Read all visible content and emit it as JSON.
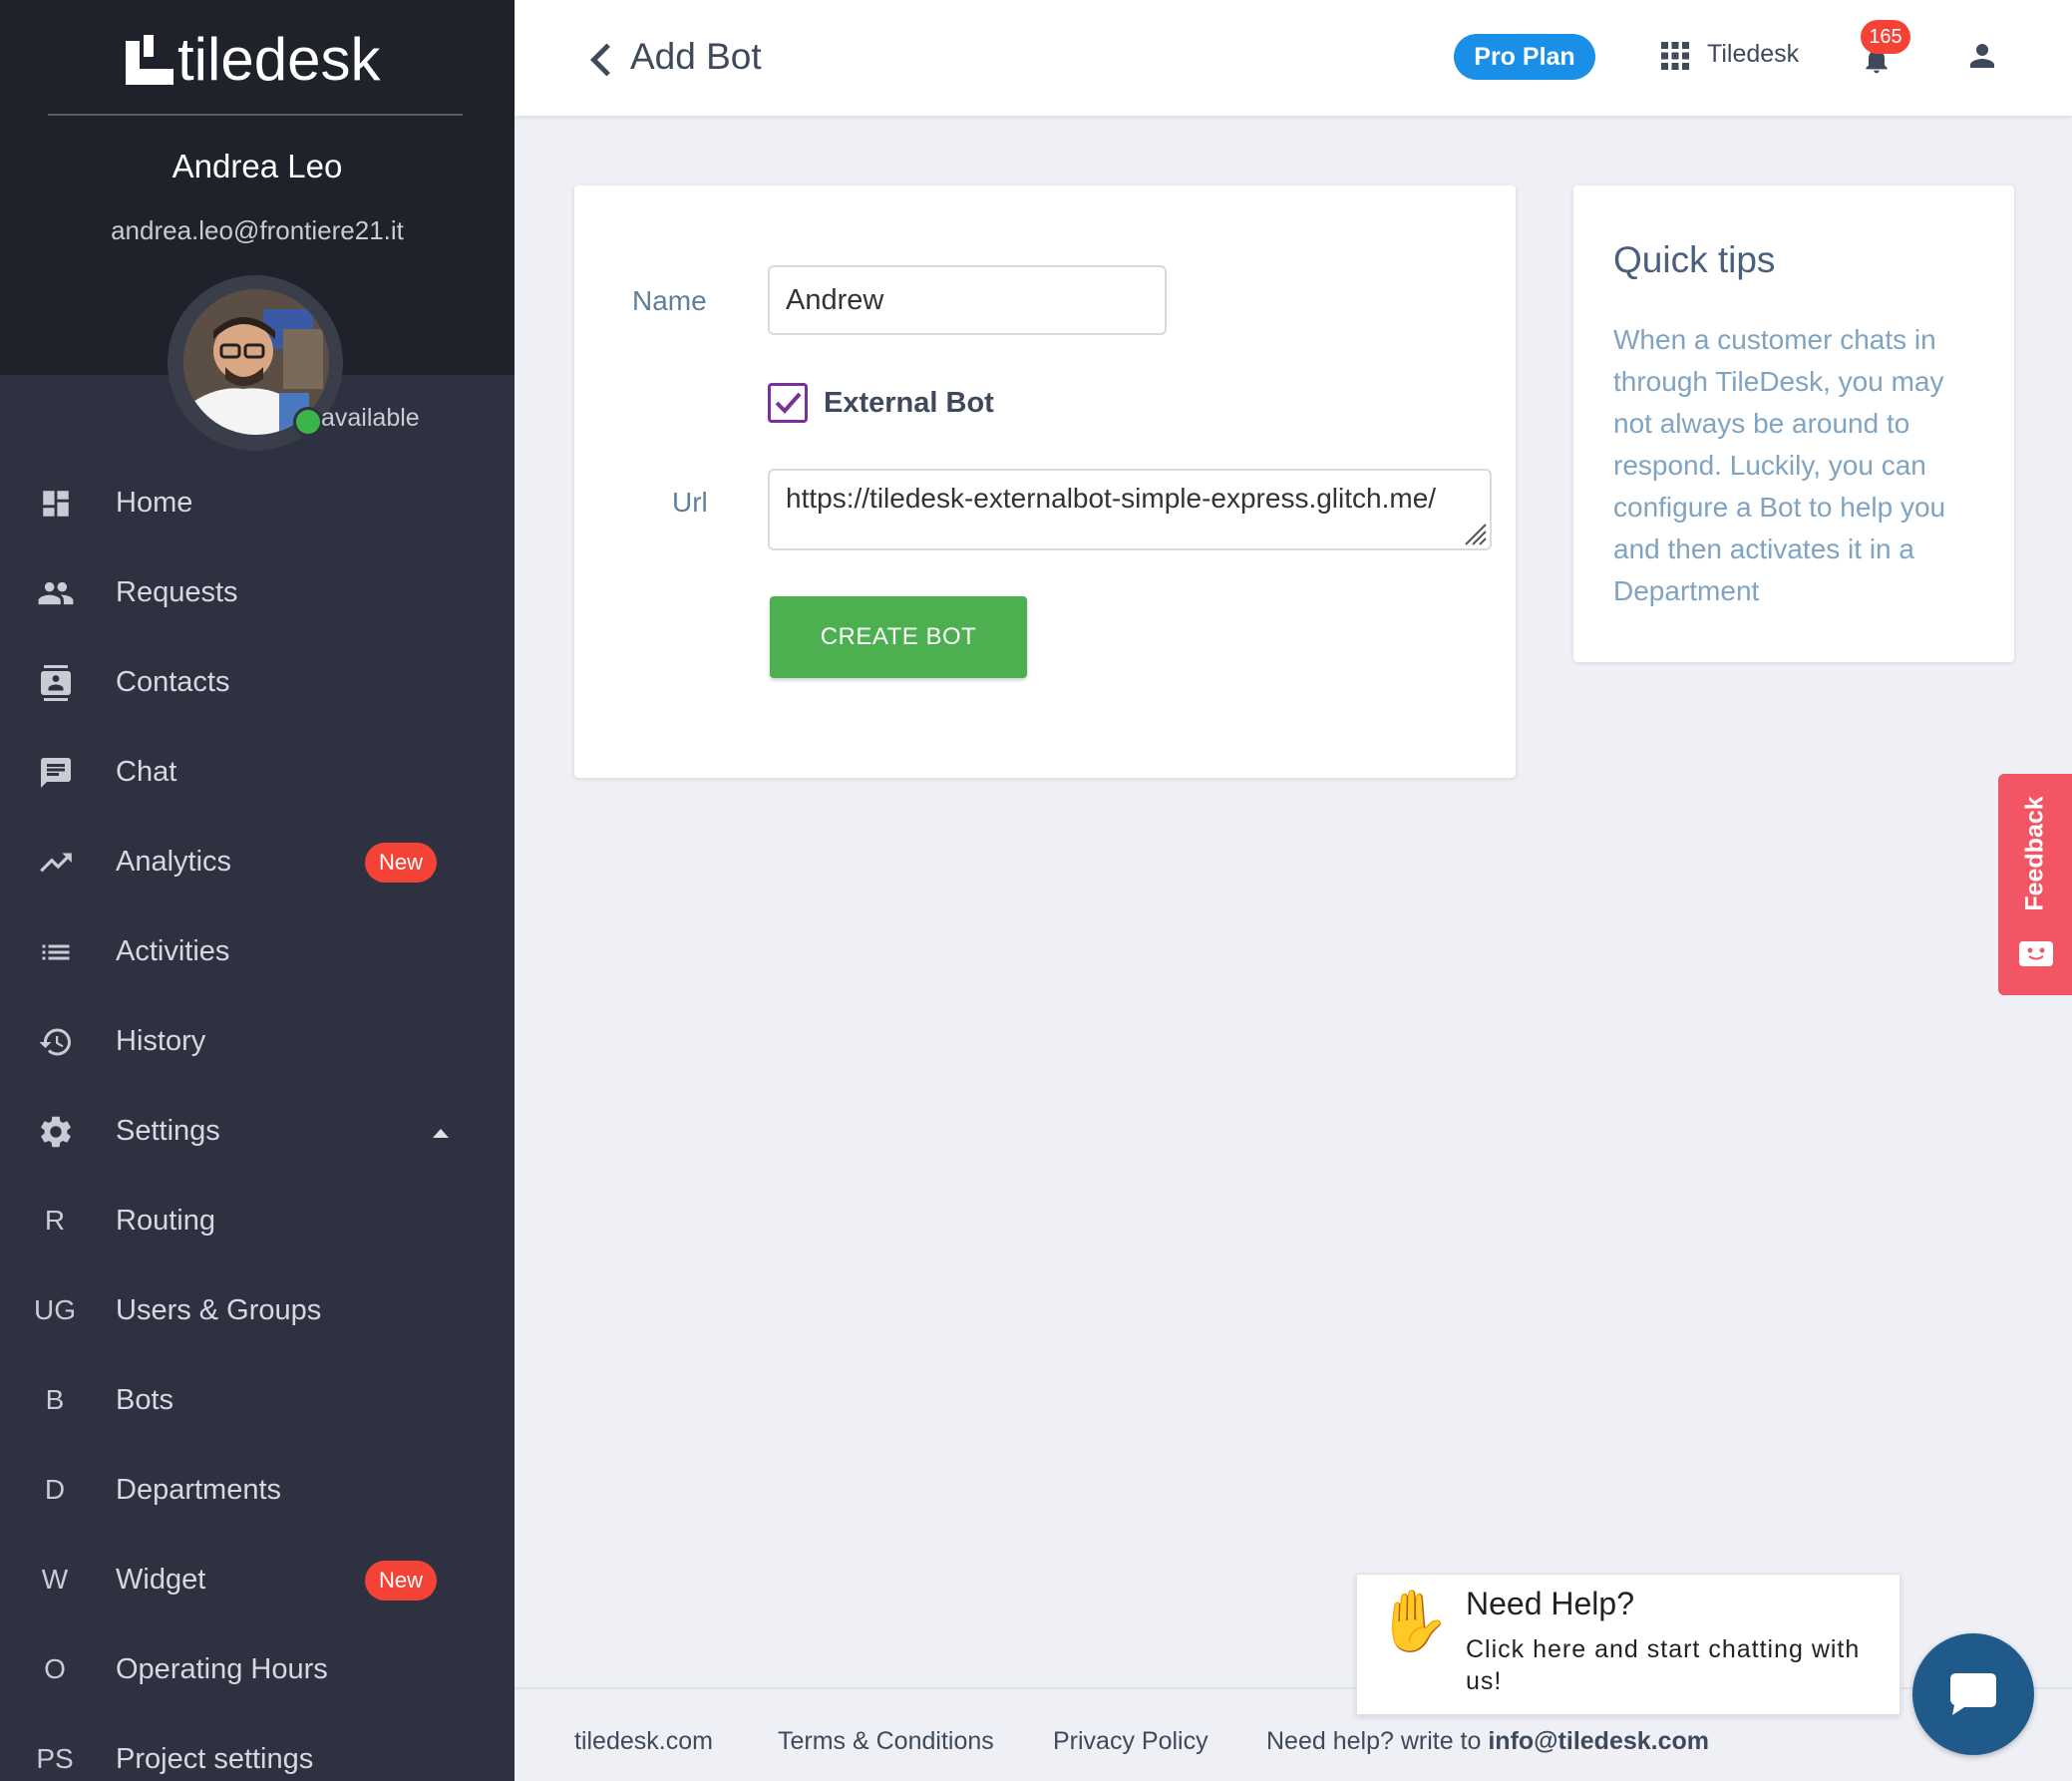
{
  "app": {
    "logo_text": "tiledesk"
  },
  "sidebar": {
    "user_name": "Andrea Leo",
    "user_email": "andrea.leo@frontiere21.it",
    "status": "available",
    "items": [
      {
        "label": "Home",
        "icon": "dashboard-icon"
      },
      {
        "label": "Requests",
        "icon": "people-icon"
      },
      {
        "label": "Contacts",
        "icon": "contacts-icon"
      },
      {
        "label": "Chat",
        "icon": "chat-icon"
      },
      {
        "label": "Analytics",
        "icon": "trending-up-icon",
        "badge": "New"
      },
      {
        "label": "Activities",
        "icon": "list-icon"
      },
      {
        "label": "History",
        "icon": "history-icon"
      },
      {
        "label": "Settings",
        "icon": "gear-icon"
      },
      {
        "label": "Routing",
        "letter": "R"
      },
      {
        "label": "Users & Groups",
        "letter": "UG"
      },
      {
        "label": "Bots",
        "letter": "B"
      },
      {
        "label": "Departments",
        "letter": "D"
      },
      {
        "label": "Widget",
        "letter": "W",
        "badge": "New"
      },
      {
        "label": "Operating Hours",
        "letter": "O"
      },
      {
        "label": "Project settings",
        "letter": "PS"
      }
    ]
  },
  "header": {
    "title": "Add Bot",
    "plan": "Pro Plan",
    "project": "Tiledesk",
    "notifications": "165"
  },
  "form": {
    "name_label": "Name",
    "name_value": "Andrew",
    "external_label": "External Bot",
    "external_checked": true,
    "url_label": "Url",
    "url_value": "https://tiledesk-externalbot-simple-express.glitch.me/",
    "submit_label": "CREATE BOT"
  },
  "tips": {
    "title": "Quick tips",
    "text": "When a customer chats in through TileDesk, you may not always be around to respond. Luckily, you can configure a Bot to help you and then activates it in a Department"
  },
  "feedback": {
    "label": "Feedback"
  },
  "footer": {
    "site": "tiledesk.com",
    "terms": "Terms & Conditions",
    "privacy": "Privacy Policy",
    "help_prefix": "Need help? write to ",
    "help_email": "info@tiledesk.com"
  },
  "help_widget": {
    "title": "Need Help?",
    "text": "Click here and start chatting with us!"
  },
  "colors": {
    "sidebar_bg": "#2d3140",
    "accent_blue": "#1a8fe8",
    "create_green": "#4caf50",
    "badge_red": "#f44336",
    "feedback_red": "#f25563"
  }
}
